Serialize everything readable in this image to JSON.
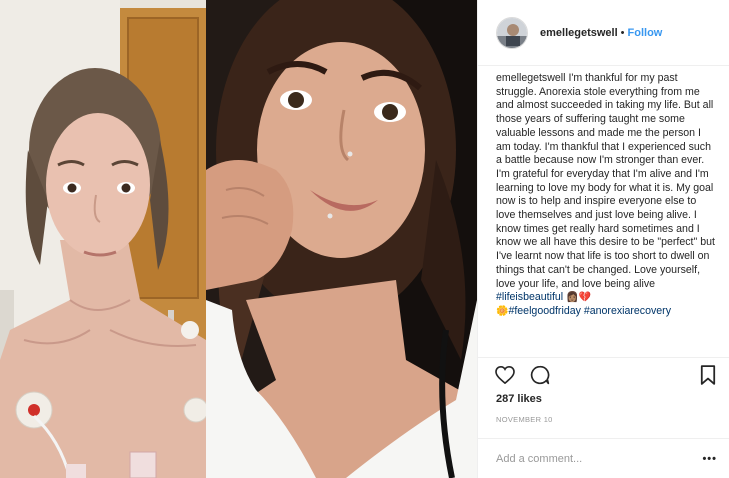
{
  "post": {
    "username": "emellegetswell",
    "dot": "•",
    "follow_label": "Follow",
    "caption": {
      "username": "emellegetswell",
      "text": "I'm thankful for my past struggle. Anorexia stole everything from me and almost succeeded in taking my life. But all those years of suffering taught me some valuable lessons and made me the person I am today. I'm thankful that I experienced such a battle because now I'm stronger than ever. I'm grateful for everyday that I'm alive and I'm learning to love my body for what it is. My goal now is to help and inspire everyone else to love themselves and just love being alive. I know times get really hard sometimes and I know we all have this desire to be \"perfect\" but I've learnt now that life is too short to dwell on things that can't be changed. Love yourself, love your life, and love being alive",
      "hashtag_1": "#lifeisbeautiful",
      "emoji_1": "👩🏽💔",
      "emoji_2": "🌼",
      "hashtag_2": "#feelgoodfriday",
      "hashtag_3": "#anorexiarecovery"
    },
    "likes": "287 likes",
    "date": "NOVEMBER 10",
    "comment_placeholder": "Add a comment...",
    "more_label": "•••",
    "icons": {
      "like": "heart-icon",
      "comment": "speech-bubble-icon",
      "save": "bookmark-icon"
    },
    "colors": {
      "link": "#3897f0",
      "hashtag": "#003569",
      "text": "#262626",
      "muted": "#999999",
      "border": "#efefef"
    }
  }
}
